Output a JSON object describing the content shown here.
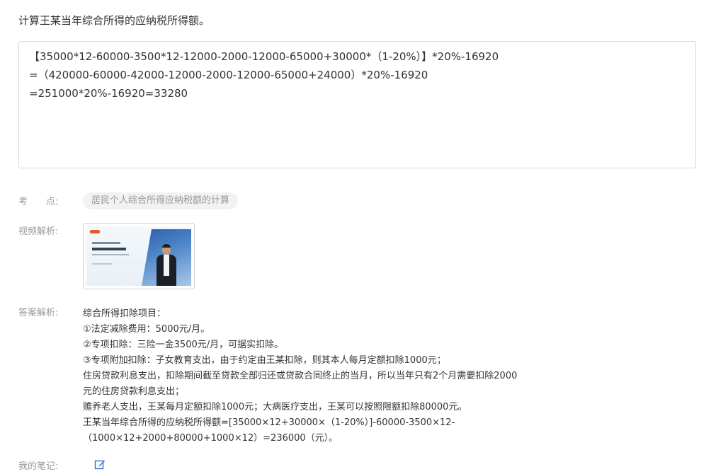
{
  "question": {
    "title": "计算王某当年综合所得的应纳税所得额。"
  },
  "answer_box": {
    "lines": [
      "【35000*12-60000-3500*12-12000-2000-12000-65000+30000*（1-20%）】*20%-16920",
      "=（420000-60000-42000-12000-2000-12000-65000+24000）*20%-16920",
      "=251000*20%-16920=33280"
    ]
  },
  "kaodian": {
    "label_part1": "考",
    "label_part2": "点:",
    "tag": "居民个人综合所得应纳税额的计算"
  },
  "video": {
    "label": "视频解析:"
  },
  "analysis": {
    "label": "答案解析:",
    "lines": [
      "综合所得扣除项目：",
      "①法定减除费用：5000元/月。",
      "②专项扣除：三险一金3500元/月，可据实扣除。",
      "③专项附加扣除：子女教育支出，由于约定由王某扣除，则其本人每月定额扣除1000元；",
      "住房贷款利息支出，扣除期间截至贷款全部归还或贷款合同终止的当月，所以当年只有2个月需要扣除2000",
      "元的住房贷款利息支出；",
      "赡养老人支出，王某每月定额扣除1000元；大病医疗支出，王某可以按照限额扣除80000元。",
      "王某当年综合所得的应纳税所得额=[35000×12+30000×（1-20%）]-60000-3500×12-",
      "（1000×12+2000+80000+1000×12）=236000（元）。"
    ]
  },
  "notes": {
    "label": "我的笔记:",
    "icon": "edit-icon",
    "icon_color": "#2b6fd6"
  }
}
